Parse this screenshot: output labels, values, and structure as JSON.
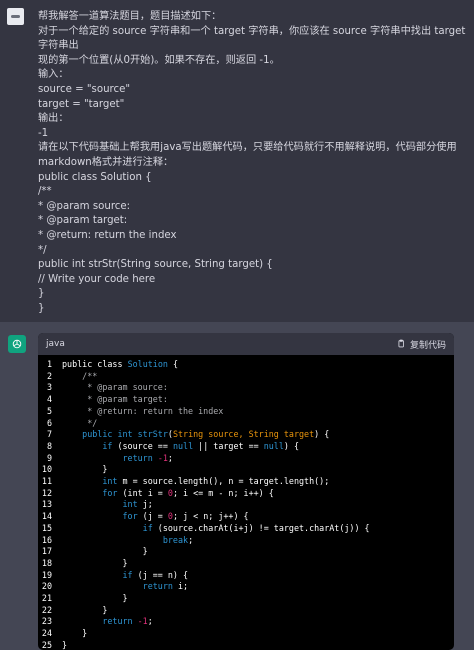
{
  "user": {
    "lines": [
      "帮我解答一道算法题目，题目描述如下：",
      "对于一个给定的 source 字符串和一个 target 字符串，你应该在 source 字符串中找出 target 字符串出",
      "现的第一个位置(从0开始)。如果不存在，则返回 -1。",
      "输入：",
      "source = \"source\"",
      "target = \"target\"",
      "输出：",
      "-1",
      "请在以下代码基础上帮我用java写出题解代码，只要给代码就行不用解释说明，代码部分使用",
      "markdown格式并进行注释：",
      "public class Solution {",
      "/**",
      "* @param source:",
      "* @param target:",
      "* @return: return the index",
      "*/",
      "public int strStr(String source, String target) {",
      "// Write your code here",
      "}",
      "}"
    ]
  },
  "assistant": {
    "code_language": "java",
    "copy_label": "复制代码",
    "code_lines": [
      [
        [
          "",
          "public class "
        ],
        [
          "cl",
          "Solution"
        ],
        [
          "",
          " {"
        ]
      ],
      [
        [
          "cm",
          "    /**"
        ]
      ],
      [
        [
          "cm",
          "     * @param source:"
        ]
      ],
      [
        [
          "cm",
          "     * @param target:"
        ]
      ],
      [
        [
          "cm",
          "     * @return: return the index"
        ]
      ],
      [
        [
          "cm",
          "     */"
        ]
      ],
      [
        [
          "kw",
          "    public int "
        ],
        [
          "cl",
          "strStr"
        ],
        [
          "",
          "("
        ],
        [
          "ty",
          "String source, String target"
        ],
        [
          "",
          ") {"
        ]
      ],
      [
        [
          "kw",
          "        if"
        ],
        [
          "",
          " (source == "
        ],
        [
          "kw",
          "null"
        ],
        [
          "",
          " || target == "
        ],
        [
          "kw",
          "null"
        ],
        [
          "",
          ") {"
        ]
      ],
      [
        [
          "kw",
          "            return"
        ],
        [
          "",
          " "
        ],
        [
          "num",
          "-1"
        ],
        [
          "",
          ";"
        ]
      ],
      [
        [
          "",
          "        }"
        ]
      ],
      [
        [
          "kw",
          "        int"
        ],
        [
          "",
          " m = source.length(), n = target.length();"
        ]
      ],
      [
        [
          "kw",
          "        for"
        ],
        [
          "",
          " (int i = "
        ],
        [
          "num",
          "0"
        ],
        [
          "",
          "; i <= m - n; i++) {"
        ]
      ],
      [
        [
          "kw",
          "            int"
        ],
        [
          "",
          " j;"
        ]
      ],
      [
        [
          "kw",
          "            for"
        ],
        [
          "",
          " (j = "
        ],
        [
          "num",
          "0"
        ],
        [
          "",
          "; j < n; j++) {"
        ]
      ],
      [
        [
          "kw",
          "                if"
        ],
        [
          "",
          " (source.charAt(i+j) != target.charAt(j)) {"
        ]
      ],
      [
        [
          "kw",
          "                    break"
        ],
        [
          "",
          ";"
        ]
      ],
      [
        [
          "",
          "                }"
        ]
      ],
      [
        [
          "",
          "            }"
        ]
      ],
      [
        [
          "kw",
          "            if"
        ],
        [
          "",
          " (j == n) {"
        ]
      ],
      [
        [
          "kw",
          "                return"
        ],
        [
          "",
          " i;"
        ]
      ],
      [
        [
          "",
          "            }"
        ]
      ],
      [
        [
          "",
          "        }"
        ]
      ],
      [
        [
          "kw",
          "        return"
        ],
        [
          "",
          " "
        ],
        [
          "num",
          "-1"
        ],
        [
          "",
          ";"
        ]
      ],
      [
        [
          "",
          "    }"
        ]
      ],
      [
        [
          "",
          "}"
        ]
      ]
    ]
  }
}
